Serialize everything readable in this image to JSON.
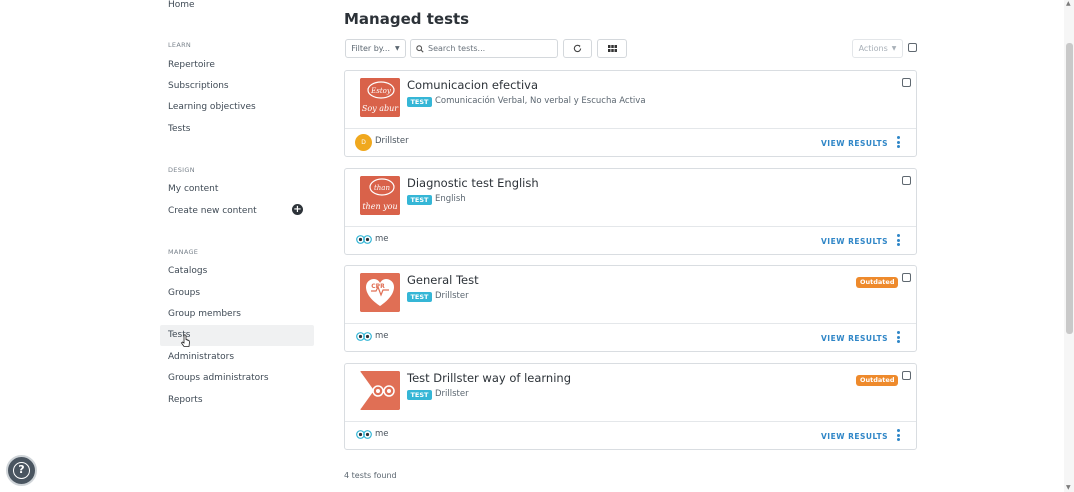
{
  "sidebar": {
    "home": "Home",
    "learn_header": "LEARN",
    "learn_items": [
      "Repertoire",
      "Subscriptions",
      "Learning objectives",
      "Tests"
    ],
    "design_header": "DESIGN",
    "design_items": [
      "My content",
      "Create new content"
    ],
    "manage_header": "MANAGE",
    "manage_items": [
      "Catalogs",
      "Groups",
      "Group members",
      "Tests",
      "Administrators",
      "Groups administrators",
      "Reports"
    ],
    "active_item": "Tests"
  },
  "main": {
    "title": "Managed tests",
    "filter_label": "Filter by...",
    "search_placeholder": "Search tests...",
    "actions_label": "Actions",
    "view_results_label": "VIEW RESULTS",
    "test_badge": "TEST",
    "outdated_label": "Outdated",
    "cards": [
      {
        "title": "Comunicacion efectiva",
        "subtitle": "Comunicación Verbal, No verbal y Escucha Activa",
        "owner": "Drillster",
        "owner_initials": "D",
        "outdated": false,
        "thumb_text": "Estoy Soy abur"
      },
      {
        "title": "Diagnostic test English",
        "subtitle": "English",
        "owner": "me",
        "outdated": false,
        "thumb_text": "than then you"
      },
      {
        "title": "General Test",
        "subtitle": "Drillster",
        "owner": "me",
        "outdated": true,
        "thumb_text": "CPR"
      },
      {
        "title": "Test Drillster way of learning",
        "subtitle": "Drillster",
        "owner": "me",
        "outdated": true,
        "thumb_text": ""
      }
    ],
    "count_text": "4 tests found"
  },
  "colors": {
    "accent": "#2f86c7",
    "badge": "#35b6d6",
    "outdated": "#ee8a2c",
    "thumb": "#e06f55",
    "avatar": "#f0a81e"
  },
  "icons": {
    "help": "?",
    "refresh": "refresh-icon",
    "grid": "grid-icon",
    "search": "search-icon",
    "add": "plus-circle-icon"
  }
}
